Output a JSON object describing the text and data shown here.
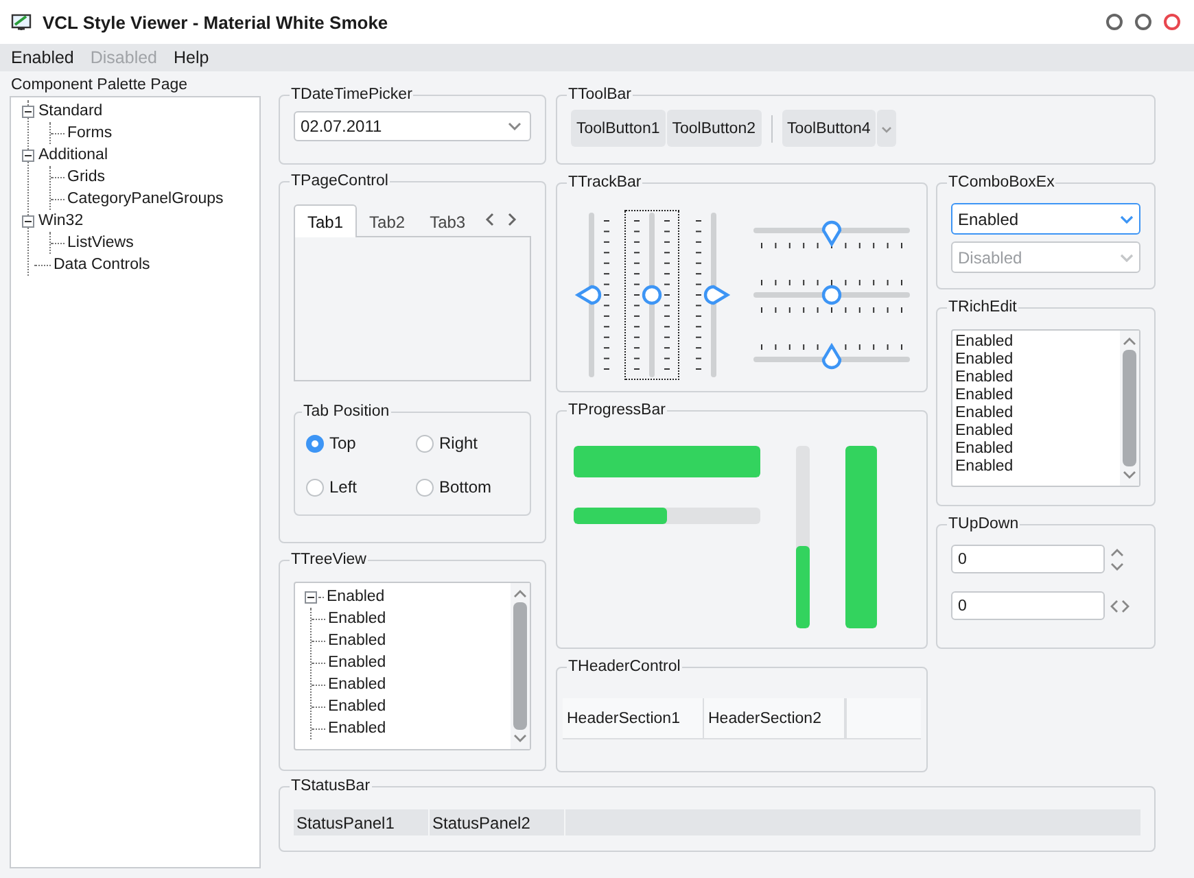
{
  "window": {
    "title": "VCL Style Viewer - Material White Smoke"
  },
  "menu": [
    {
      "label": "Enabled",
      "disabled": false
    },
    {
      "label": "Disabled",
      "disabled": true
    },
    {
      "label": "Help",
      "disabled": false
    }
  ],
  "palette": {
    "label": "Component Palette Page",
    "items": [
      {
        "label": "Standard",
        "expanded": true,
        "children": [
          {
            "label": "Forms"
          }
        ]
      },
      {
        "label": "Additional",
        "expanded": true,
        "children": [
          {
            "label": "Grids"
          },
          {
            "label": "CategoryPanelGroups"
          }
        ]
      },
      {
        "label": "Win32",
        "expanded": true,
        "children": [
          {
            "label": "ListViews"
          }
        ]
      },
      {
        "label": "Data Controls"
      }
    ]
  },
  "date_time_picker": {
    "title": "TDateTimePicker",
    "value": "02.07.2011"
  },
  "toolbar": {
    "title": "TToolBar",
    "buttons": [
      {
        "kind": "button",
        "label": "ToolButton1"
      },
      {
        "kind": "button",
        "label": "ToolButton2"
      },
      {
        "kind": "separator"
      },
      {
        "kind": "button",
        "label": "ToolButton4"
      },
      {
        "kind": "dropdown"
      }
    ]
  },
  "page_control": {
    "title": "TPageControl",
    "tabs": [
      {
        "label": "Tab1",
        "selected": true
      },
      {
        "label": "Tab2",
        "selected": false
      },
      {
        "label": "Tab3",
        "selected": false
      }
    ],
    "tab_position": {
      "title": "Tab Position",
      "options": [
        {
          "label": "Top",
          "selected": true
        },
        {
          "label": "Right",
          "selected": false
        },
        {
          "label": "Left",
          "selected": false
        },
        {
          "label": "Bottom",
          "selected": false
        }
      ]
    }
  },
  "trackbar": {
    "title": "TTrackBar",
    "vertical": [
      {
        "kind": "right",
        "focused": false,
        "level": 0.5
      },
      {
        "kind": "both",
        "focused": true,
        "level": 0.5
      },
      {
        "kind": "left",
        "focused": false,
        "level": 0.5
      }
    ],
    "horizontal": [
      {
        "kind": "below",
        "focused": false,
        "level": 0.5
      },
      {
        "kind": "both",
        "focused": false,
        "level": 0.5
      },
      {
        "kind": "above",
        "focused": false,
        "level": 0.5
      }
    ]
  },
  "combobox_ex": {
    "title": "TComboBoxEx",
    "boxes": [
      {
        "value": "Enabled",
        "disabled": false,
        "focused": true
      },
      {
        "value": "Disabled",
        "disabled": true,
        "focused": false
      }
    ]
  },
  "rich_edit": {
    "title": "TRichEdit",
    "lines": [
      "Enabled",
      "Enabled",
      "Enabled",
      "Enabled",
      "Enabled",
      "Enabled",
      "Enabled",
      "Enabled"
    ]
  },
  "progress_bar": {
    "title": "TProgressBar",
    "horizontal": [
      {
        "kind": "thick",
        "level": 1
      },
      {
        "kind": "thin",
        "level": 0.5
      }
    ],
    "vertical": [
      {
        "kind": "thin",
        "level": 0.45
      },
      {
        "kind": "thick",
        "level": 1
      }
    ]
  },
  "updown": {
    "title": "TUpDown",
    "fields": [
      {
        "value": "0",
        "kind": "vertical"
      },
      {
        "value": "0",
        "kind": "horizontal"
      }
    ]
  },
  "tree_view": {
    "title": "TTreeView",
    "items": [
      {
        "label": "Enabled",
        "expanded": true,
        "children": [
          {
            "label": "Enabled"
          },
          {
            "label": "Enabled"
          },
          {
            "label": "Enabled"
          },
          {
            "label": "Enabled"
          },
          {
            "label": "Enabled"
          },
          {
            "label": "Enabled"
          }
        ]
      }
    ]
  },
  "header_control": {
    "title": "THeaderControl",
    "sections": [
      "HeaderSection1",
      "HeaderSection2"
    ]
  },
  "status_bar": {
    "title": "TStatusBar",
    "panels": [
      "StatusPanel1",
      "StatusPanel2"
    ]
  }
}
